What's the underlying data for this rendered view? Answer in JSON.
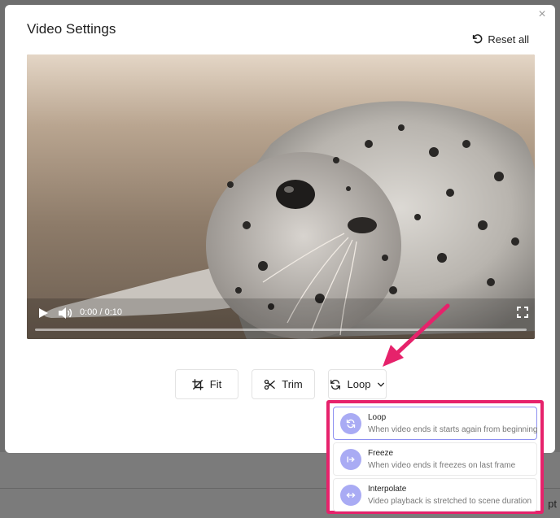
{
  "modal": {
    "title": "Video Settings",
    "reset_label": "Reset all",
    "close_glyph": "×"
  },
  "video": {
    "time": "0:00 / 0:10",
    "progress": 0
  },
  "toolbar": {
    "fit_label": "Fit",
    "trim_label": "Trim",
    "loop_label": "Loop"
  },
  "dropdown": {
    "options": [
      {
        "title": "Loop",
        "description": "When video ends it starts again from beginning",
        "icon": "loop-icon",
        "selected": true
      },
      {
        "title": "Freeze",
        "description": "When video ends it freezes on last frame",
        "icon": "freeze-icon",
        "selected": false
      },
      {
        "title": "Interpolate",
        "description": "Video playback is stretched to scene duration",
        "icon": "interpolate-icon",
        "selected": false
      }
    ]
  },
  "backdrop": {
    "trailing_text": "pt"
  },
  "colors": {
    "accent": "#e6226b",
    "option_icon_bg": "#a9abf4",
    "selected_border": "#8c8ff0"
  }
}
